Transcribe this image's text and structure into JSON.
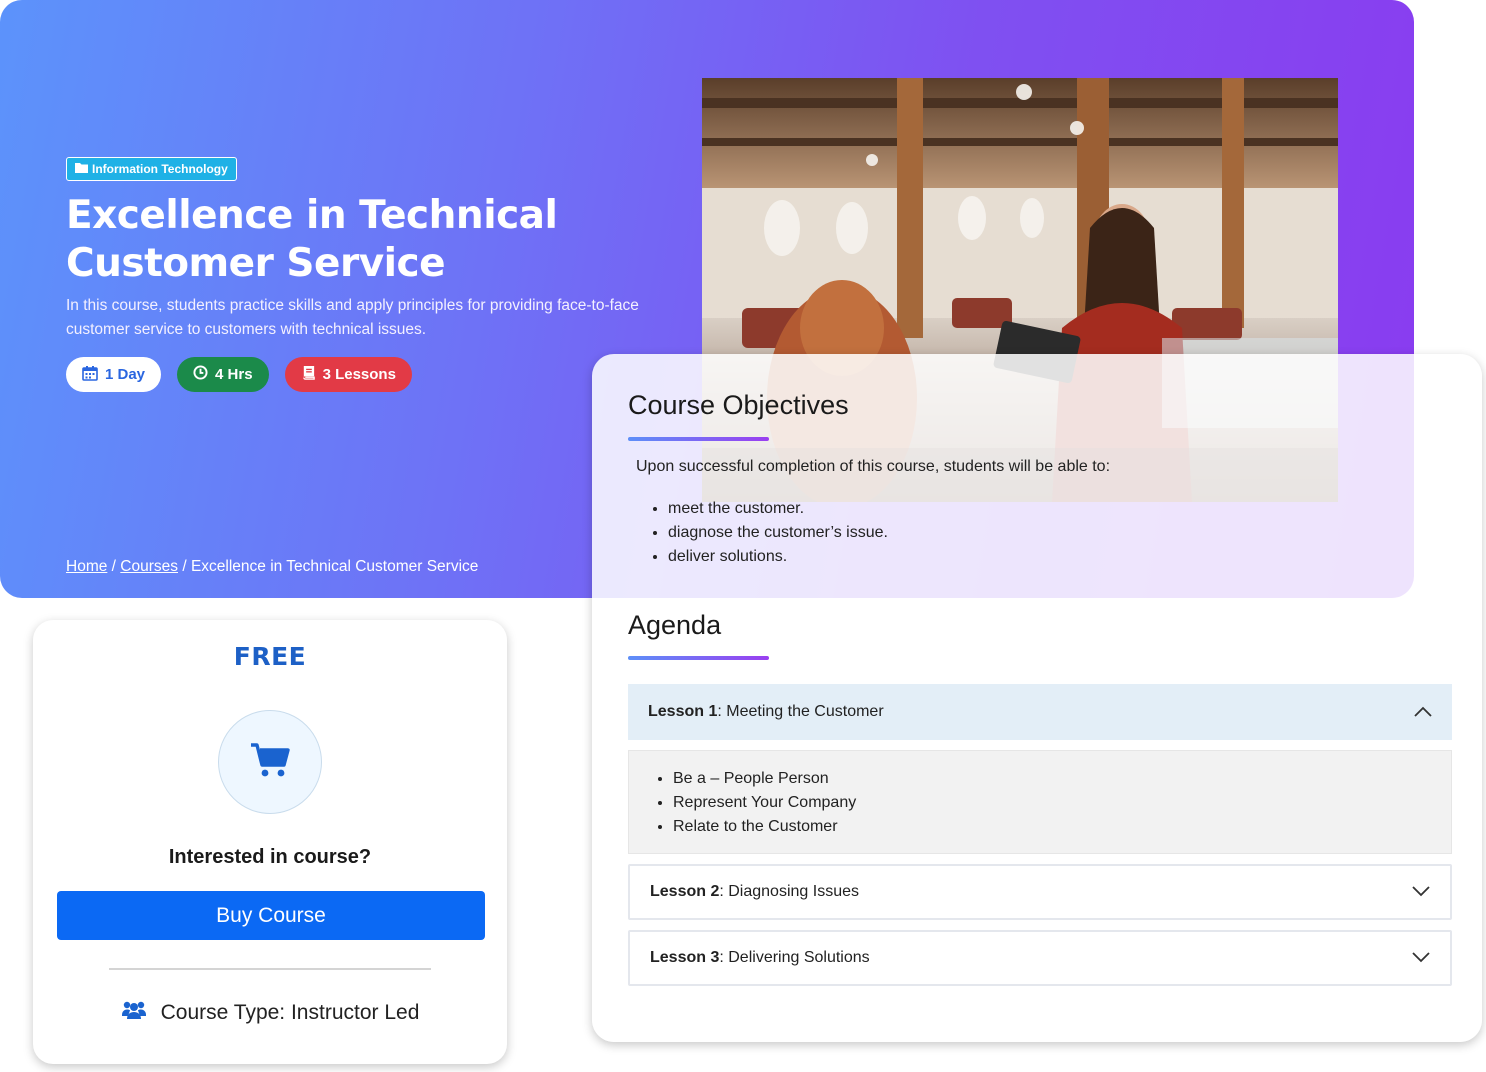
{
  "hero": {
    "category": "Information Technology",
    "title": "Excellence in Technical Customer Service",
    "description": "In this course, students practice skills and apply principles for providing face-to-face customer service to customers with technical issues.",
    "pills": {
      "duration": "1 Day",
      "hours": "4 Hrs",
      "lessons": "3 Lessons"
    },
    "breadcrumb": {
      "home": "Home",
      "sep": "/",
      "courses": "Courses",
      "current": "Excellence in Technical Customer Service"
    }
  },
  "objectives": {
    "title": "Course Objectives",
    "intro": "Upon successful completion of this course, students will be able to:",
    "items": [
      "meet the customer.",
      "diagnose the customer’s issue.",
      "deliver solutions."
    ]
  },
  "agenda": {
    "title": "Agenda",
    "lessons": [
      {
        "label": "Lesson 1",
        "name": ": Meeting the Customer",
        "topics": [
          "Be a – People Person",
          "Represent Your Company",
          "Relate to the Customer"
        ]
      },
      {
        "label": "Lesson 2",
        "name": ": Diagnosing Issues"
      },
      {
        "label": "Lesson 3",
        "name": ": Delivering Solutions"
      }
    ]
  },
  "pricing": {
    "price": "FREE",
    "prompt": "Interested in course?",
    "buy_label": "Buy Course",
    "course_type": "Course Type: Instructor Led"
  },
  "icons": {
    "category": "folder-icon",
    "duration": "calendar-icon",
    "hours": "clock-icon",
    "lessons": "book-icon",
    "cart": "shopping-cart-icon",
    "course_type": "users-icon",
    "expanded": "chevron-up-icon",
    "collapsed": "chevron-down-icon"
  },
  "colors": {
    "brand_blue": "#0b69f4",
    "price_blue": "#1d60c6",
    "hours_green": "#1b8a4a",
    "lessons_red": "#e23a46",
    "gradient_start": "#5c93fb",
    "gradient_end": "#8a3bf0"
  }
}
